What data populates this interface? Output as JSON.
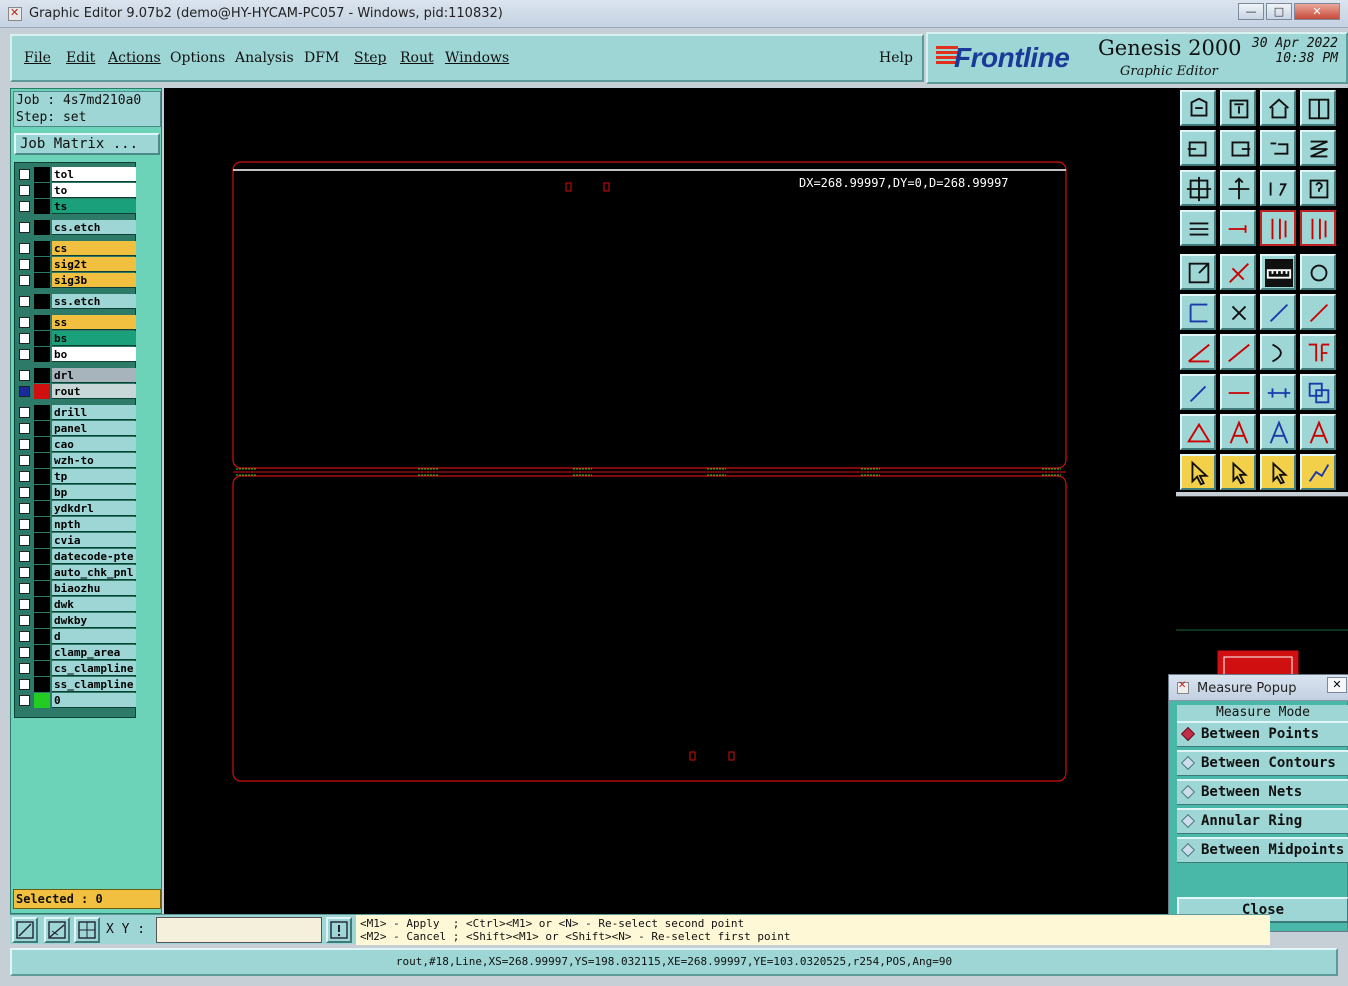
{
  "window": {
    "title": "Graphic Editor 9.07b2 (demo@HY-HYCAM-PC057 - Windows, pid:110832)"
  },
  "menu": {
    "file": "File",
    "edit": "Edit",
    "actions": "Actions",
    "options": "Options",
    "analysis": "Analysis",
    "dfm": "DFM",
    "step": "Step",
    "rout": "Rout",
    "windows": "Windows",
    "help": "Help"
  },
  "brand": {
    "logo": "Frontline",
    "product": "Genesis 2000",
    "subtitle": "Graphic Editor",
    "date": "30 Apr 2022",
    "time": "10:38 PM"
  },
  "job": {
    "job_line": "Job : 4s7md210a0",
    "step_line": "Step: set",
    "matrix_button": "Job Matrix ..."
  },
  "layers": [
    {
      "name": "tol",
      "color": "#ffffff",
      "group": 0
    },
    {
      "name": "to",
      "color": "#ffffff",
      "group": 0
    },
    {
      "name": "ts",
      "color": "#1aa07a",
      "group": 0
    },
    {
      "name": "cs.etch",
      "color": "#9ed6d6",
      "group": 1
    },
    {
      "name": "cs",
      "color": "#f2c040",
      "group": 2
    },
    {
      "name": "sig2t",
      "color": "#f2c040",
      "group": 2
    },
    {
      "name": "sig3b",
      "color": "#f2c040",
      "group": 2
    },
    {
      "name": "ss.etch",
      "color": "#9ed6d6",
      "group": 3
    },
    {
      "name": "ss",
      "color": "#f2c040",
      "group": 4
    },
    {
      "name": "bs",
      "color": "#1aa07a",
      "group": 4
    },
    {
      "name": "bo",
      "color": "#ffffff",
      "group": 4
    },
    {
      "name": "drl",
      "color": "#a8b4bc",
      "group": 5
    },
    {
      "name": "rout",
      "color": "#c8d8d8",
      "group": 5,
      "active": true
    },
    {
      "name": "drill",
      "color": "#9ed6d6",
      "group": 6
    },
    {
      "name": "panel",
      "color": "#9ed6d6",
      "group": 6
    },
    {
      "name": "cao",
      "color": "#9ed6d6",
      "group": 6
    },
    {
      "name": "wzh-to",
      "color": "#9ed6d6",
      "group": 6
    },
    {
      "name": "tp",
      "color": "#9ed6d6",
      "group": 6
    },
    {
      "name": "bp",
      "color": "#9ed6d6",
      "group": 6
    },
    {
      "name": "ydkdrl",
      "color": "#9ed6d6",
      "group": 6
    },
    {
      "name": "npth",
      "color": "#9ed6d6",
      "group": 6
    },
    {
      "name": "cvia",
      "color": "#9ed6d6",
      "group": 6
    },
    {
      "name": "datecode-pte",
      "color": "#9ed6d6",
      "group": 6
    },
    {
      "name": "auto_chk_pnl",
      "color": "#9ed6d6",
      "group": 6
    },
    {
      "name": "biaozhu",
      "color": "#9ed6d6",
      "group": 6
    },
    {
      "name": "dwk",
      "color": "#9ed6d6",
      "group": 6
    },
    {
      "name": "dwkby",
      "color": "#9ed6d6",
      "group": 6
    },
    {
      "name": "d",
      "color": "#9ed6d6",
      "group": 6
    },
    {
      "name": "clamp_area",
      "color": "#9ed6d6",
      "group": 6
    },
    {
      "name": "cs_clampline",
      "color": "#9ed6d6",
      "group": 6
    },
    {
      "name": "ss_clampline",
      "color": "#9ed6d6",
      "group": 6
    },
    {
      "name": "0",
      "color": "#9ed6d6",
      "group": 6,
      "swatch": "#22cc22"
    }
  ],
  "selected": "Selected : 0",
  "canvas": {
    "measure_readout": "DX=268.99997,DY=0,D=268.99997"
  },
  "measure_popup": {
    "title": "Measure Popup",
    "header": "Measure Mode",
    "options": [
      "Between Points",
      "Between Contours",
      "Between Nets",
      "Annular Ring",
      "Between Midpoints"
    ],
    "selected_index": 0,
    "close_label": "Close"
  },
  "bottom": {
    "xy_label": "X Y :",
    "xy_value": "",
    "help_line1": "<M1> - Apply  ; <Ctrl><M1> or <N> - Re-select second point",
    "help_line2": "<M2> - Cancel ; <Shift><M1> or <Shift><N> - Re-select first point"
  },
  "status": "rout,#18,Line,XS=268.99997,YS=198.032115,XE=268.99997,YE=103.0320525,r254,POS,Ang=90",
  "colors": {
    "accent": "#9ed6d6",
    "panel": "#6dd3b8",
    "rout": "#d01010",
    "tab": "#22cc22"
  }
}
